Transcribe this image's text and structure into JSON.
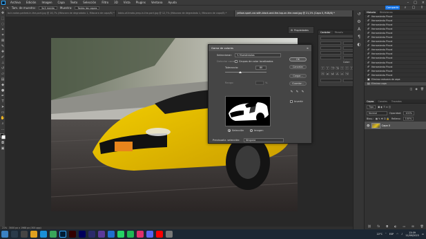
{
  "menu": {
    "items": [
      "Archivo",
      "Edición",
      "Imagen",
      "Capa",
      "Texto",
      "Selección",
      "Filtro",
      "3D",
      "Vista",
      "Plugins",
      "Ventana",
      "Ayuda"
    ]
  },
  "options": {
    "size_label": "Tam. de muestra:",
    "size_value": "3x3 media",
    "sample_label": "Muestra:",
    "sample_value": "Todas las capas",
    "share_label": "Compartir"
  },
  "tabs": [
    {
      "label": "la-ti-nolan-parked-in-the-port.jpg @ 16,7% (Máscara de degradado 1, Máscara de capa/8) *",
      "active": false
    },
    {
      "label": "tablo-of-tirado-jeep-in-the-port.jpg @ 12,7% (Máscara de degradado 1, Máscara de capa/8) *",
      "active": false
    },
    {
      "label": "yellow-sport-car-with-black-and-the-top-on-the-road.jpg @ 21,2% (Capa 0, RGB/8) *",
      "active": true
    }
  ],
  "status": {
    "zoom": "21%",
    "doc": "3000 px x 1968 px (300 ppp)"
  },
  "props_mini": {
    "label": "Propiedades"
  },
  "char_panel": {
    "tabs": [
      "Carácter",
      "Párrafo"
    ],
    "color_label": "Color:",
    "color": "#e6b800"
  },
  "dialog": {
    "title": "Gama de colores",
    "select_label": "Seleccionar:",
    "select_value": "Muestreados",
    "detect_faces_label": "Detectar caras",
    "localized_label": "Grupos de color localizados",
    "tolerance_label": "Tolerancia:",
    "tolerance_value": "80",
    "range_label": "Rango:",
    "range_unit": "%",
    "selection_radio": "Selección",
    "image_radio": "Imagen",
    "preview_label": "Previsualiz. selección:",
    "preview_value": "Ninguna",
    "ok": "OK",
    "cancel": "Cancelar",
    "load": "Cargar...",
    "save": "Guardar...",
    "invert": "Invertir"
  },
  "history": {
    "tabs": [
      "Historia",
      "Bibliotecas"
    ],
    "rows": [
      "Herramienta Pincel",
      "Herramienta Pincel",
      "Herramienta Pincel",
      "Herramienta Pincel",
      "Herramienta Pincel",
      "Herramienta Pincel",
      "Herramienta Pincel",
      "Herramienta Pincel",
      "Herramienta Pincel",
      "Herramienta Pincel",
      "Herramienta Pincel",
      "Herramienta Pincel",
      "Herramienta Pincel",
      "Herramienta Pincel",
      "Herramienta Pincel",
      "Eliminar máscara de capa",
      "Eliminar capa"
    ]
  },
  "layers": {
    "tabs": [
      "Capas",
      "Canales",
      "Trazados"
    ],
    "kind": "Tipo",
    "blend": "Normal",
    "opacity_label": "Opacidad:",
    "opacity": "100%",
    "lock_label": "Bloq.:",
    "fill_label": "Relleno:",
    "fill": "100%",
    "layer_name": "Capa 0"
  },
  "taskbar": {
    "lang": "ESP",
    "time": "13:09",
    "date": "11/09/2023",
    "weather": "22°C"
  }
}
